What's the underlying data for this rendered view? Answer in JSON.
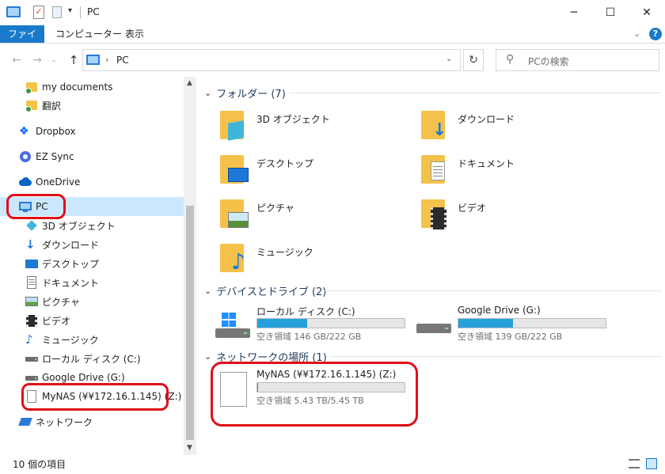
{
  "window": {
    "title": "PC",
    "minimize": "─",
    "maximize": "☐",
    "close": "✕"
  },
  "ribbon": {
    "tabs": [
      "ファイル",
      "コンピューター",
      "表示"
    ]
  },
  "address": {
    "path": "PC",
    "search_placeholder": "PCの検索"
  },
  "nav": {
    "items": [
      {
        "label": "my documents",
        "icon": "sync-folder-icon"
      },
      {
        "label": "翻訳",
        "icon": "sync-folder-icon"
      },
      {
        "label": "Dropbox",
        "icon": "dropbox-icon"
      },
      {
        "label": "EZ Sync",
        "icon": "ezsync-icon"
      },
      {
        "label": "OneDrive",
        "icon": "onedrive-icon"
      },
      {
        "label": "PC",
        "icon": "pc-icon",
        "selected": true
      },
      {
        "label": "3D オブジェクト",
        "icon": "3d-objects-icon"
      },
      {
        "label": "ダウンロード",
        "icon": "download-icon"
      },
      {
        "label": "デスクトップ",
        "icon": "desktop-icon"
      },
      {
        "label": "ドキュメント",
        "icon": "document-icon"
      },
      {
        "label": "ピクチャ",
        "icon": "pictures-icon"
      },
      {
        "label": "ビデオ",
        "icon": "videos-icon"
      },
      {
        "label": "ミュージック",
        "icon": "music-icon"
      },
      {
        "label": "ローカル ディスク (C:)",
        "icon": "drive-icon"
      },
      {
        "label": "Google Drive (G:)",
        "icon": "drive-icon"
      },
      {
        "label": "MyNAS (¥¥172.16.1.145) (Z:)",
        "icon": "network-drive-icon"
      },
      {
        "label": "ネットワーク",
        "icon": "network-icon"
      }
    ]
  },
  "content": {
    "folders_header": "フォルダー (7)",
    "folders": [
      {
        "label": "3D オブジェクト",
        "icon": "3d-objects-folder-icon"
      },
      {
        "label": "ダウンロード",
        "icon": "downloads-folder-icon"
      },
      {
        "label": "デスクトップ",
        "icon": "desktop-folder-icon"
      },
      {
        "label": "ドキュメント",
        "icon": "documents-folder-icon"
      },
      {
        "label": "ピクチャ",
        "icon": "pictures-folder-icon"
      },
      {
        "label": "ビデオ",
        "icon": "videos-folder-icon"
      },
      {
        "label": "ミュージック",
        "icon": "music-folder-icon"
      }
    ],
    "drives_header": "デバイスとドライブ (2)",
    "drives": [
      {
        "name": "ローカル ディスク (C:)",
        "free": "空き領域 146 GB/222 GB",
        "used_fraction": 0.34,
        "icon": "windows-drive-icon"
      },
      {
        "name": "Google Drive (G:)",
        "free": "空き領域 139 GB/222 GB",
        "used_fraction": 0.37,
        "icon": "drive-icon"
      }
    ],
    "network_header": "ネットワークの場所 (1)",
    "network": [
      {
        "name": "MyNAS (¥¥172.16.1.145) (Z:)",
        "free": "空き領域 5.43 TB/5.45 TB",
        "used_fraction": 0.004,
        "icon": "network-drive-icon"
      }
    ]
  },
  "status": {
    "item_count": "10 個の項目"
  },
  "colors": {
    "accent": "#1979ca",
    "highlight": "#e0101a",
    "bar_fill": "#26a0da",
    "folder": "#f4c24a"
  }
}
